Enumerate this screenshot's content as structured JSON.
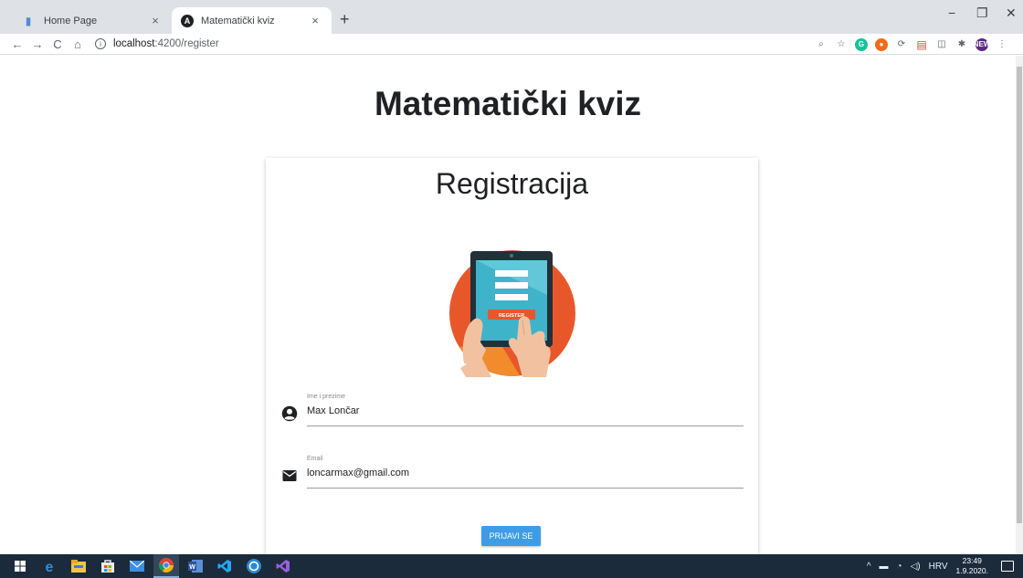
{
  "browser": {
    "tabs": [
      {
        "title": "Home Page",
        "active": false
      },
      {
        "title": "Matematički kviz",
        "active": true
      }
    ],
    "new_tab_glyph": "+",
    "tab_close_glyph": "×",
    "window_controls": {
      "minimize": "−",
      "maximize": "❐",
      "close": "✕"
    },
    "address": {
      "host": "localhost",
      "path": ":4200/register"
    },
    "nav": {
      "back": "←",
      "forward": "→",
      "reload": "C",
      "home": "⌂"
    },
    "extensions": [
      {
        "name": "zoom-icon",
        "glyph": "⌕"
      },
      {
        "name": "bookmark-star-icon",
        "glyph": "☆"
      },
      {
        "name": "grammarly-icon",
        "glyph": "G",
        "color": "#15c39a"
      },
      {
        "name": "extension-orange-icon",
        "glyph": "●",
        "color": "#f26a1b"
      },
      {
        "name": "extension-sync-icon",
        "glyph": "⟳"
      },
      {
        "name": "extension-pdf-icon",
        "glyph": "▤",
        "color": "#c2513b"
      },
      {
        "name": "extension-gray-icon",
        "glyph": "◫"
      },
      {
        "name": "extensions-puzzle-icon",
        "glyph": "✱"
      },
      {
        "name": "profile-avatar-icon",
        "glyph": "NEW",
        "color": "#5b2a86"
      },
      {
        "name": "browser-menu-icon",
        "glyph": "⋮"
      }
    ]
  },
  "page": {
    "app_title": "Matematički kviz",
    "card_title": "Registracija",
    "illustration_caption": "REGISTER",
    "fields": [
      {
        "icon": "account-circle-icon",
        "label": "Ime i prezime",
        "value": "Max Lončar"
      },
      {
        "icon": "email-icon",
        "label": "Email",
        "value": "loncarmax@gmail.com"
      }
    ],
    "submit_label": "PRIJAVI SE"
  },
  "taskbar": {
    "apps": [
      {
        "name": "windows-start-icon"
      },
      {
        "name": "edge-icon"
      },
      {
        "name": "file-explorer-icon"
      },
      {
        "name": "store-icon"
      },
      {
        "name": "mail-icon"
      },
      {
        "name": "chrome-icon",
        "active": true
      },
      {
        "name": "word-icon"
      },
      {
        "name": "vscode-icon"
      },
      {
        "name": "cortana-icon"
      },
      {
        "name": "visual-studio-icon"
      }
    ],
    "tray": {
      "language": "HRV",
      "time": "23:49",
      "date": "1.9.2020."
    },
    "colors": {
      "bar": "#1b2b3c",
      "accent": "#7ab5e5"
    }
  }
}
